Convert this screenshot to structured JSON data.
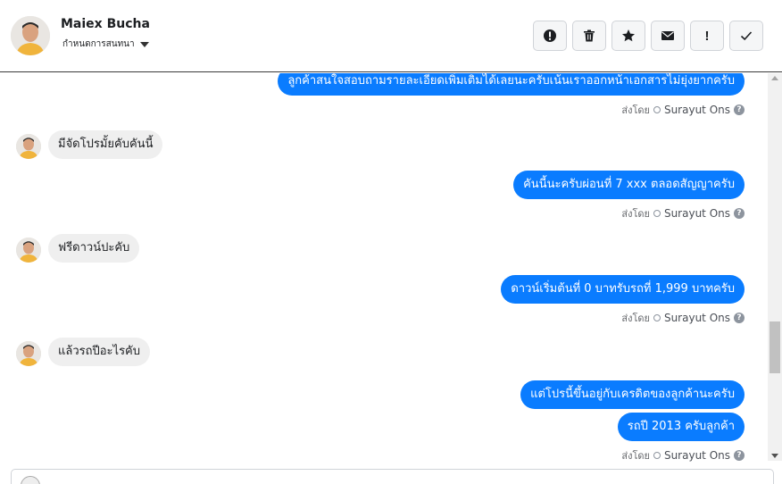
{
  "header": {
    "contact_name": "Maiex Bucha",
    "stage_label": "กำหนดการสนทนา"
  },
  "actions": [
    {
      "name": "spam-button",
      "icon": "alert-circle-icon"
    },
    {
      "name": "delete-button",
      "icon": "trash-icon"
    },
    {
      "name": "star-button",
      "icon": "star-icon"
    },
    {
      "name": "mark-unread-button",
      "icon": "envelope-icon"
    },
    {
      "name": "follow-up-button",
      "icon": "exclamation-icon",
      "glyph": "!"
    },
    {
      "name": "done-button",
      "icon": "check-icon"
    }
  ],
  "messages": {
    "m1": "ลูกค้าสนใจสอบถามรายละเอียดเพิ่มเติมได้เลยนะครับเน้นเราออกหน้าเอกสารไม่ยุ่งยากครับ",
    "m2": "มีจัดโปรมั้ยคับคันนี้",
    "m3": "คันนี้นะครับผ่อนที่ 7 xxx ตลอดสัญญาครับ",
    "m4": "ฟรีดาวน์ปะคับ",
    "m5": "ดาวน์เริ่มต้นที่ 0 บาทรับรถที่ 1,999 บาทครับ",
    "m6": "แล้วรถปีอะไรคับ",
    "m7": "แต่โปรนี้ขึ้นอยู่กับเครดิตของลูกค้านะครับ",
    "m8": "รถปี 2013 ครับลูกค้า"
  },
  "sent_by": {
    "prefix": "ส่งโดย",
    "agent": "Surayut Ons",
    "help": "?"
  },
  "colors": {
    "outgoing_bubble": "#0a7cff",
    "incoming_bubble": "#efefef"
  }
}
